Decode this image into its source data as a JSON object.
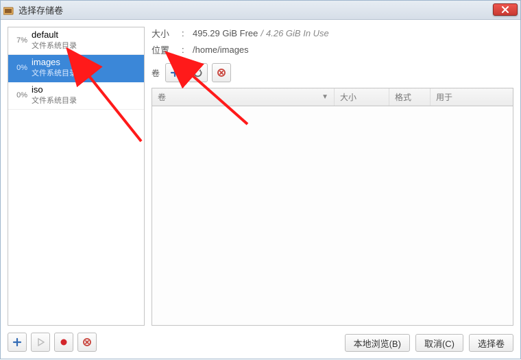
{
  "titlebar": {
    "title": "选择存储卷"
  },
  "pools": {
    "items": [
      {
        "pct": "7%",
        "name": "default",
        "sub": "文件系统目录"
      },
      {
        "pct": "0%",
        "name": "images",
        "sub": "文件系统目录"
      },
      {
        "pct": "0%",
        "name": "iso",
        "sub": "文件系统目录"
      }
    ],
    "selected_index": 1
  },
  "info": {
    "size_label": "大小",
    "free": "495.29 GiB Free",
    "sep": "/",
    "inuse": "4.26 GiB In Use",
    "loc_label": "位置",
    "loc_value": "/home/images"
  },
  "volumes": {
    "label": "卷",
    "headers": [
      "卷",
      "大小",
      "格式",
      "用于"
    ]
  },
  "buttons": {
    "browse": "本地浏览(B)",
    "cancel": "取消(C)",
    "choose": "选择卷"
  }
}
